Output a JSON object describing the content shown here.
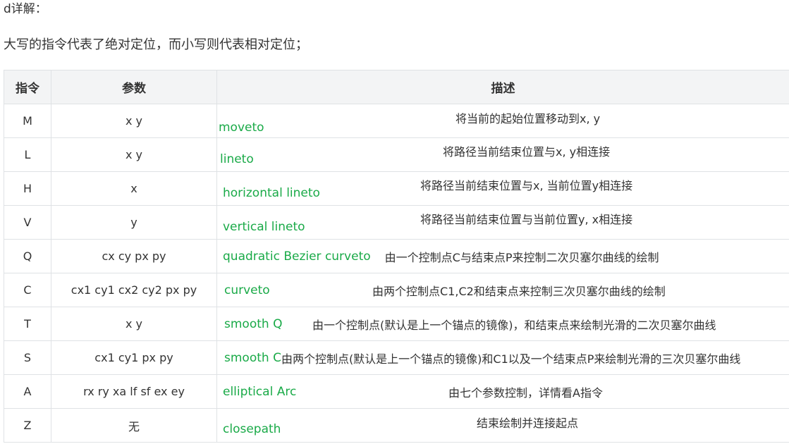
{
  "heading": "d详解：",
  "intro": "大写的指令代表了绝对定位，而小写则代表相对定位；",
  "table": {
    "headers": [
      "指令",
      "参数",
      "描述"
    ],
    "rows": [
      {
        "cmd": "M",
        "params": "x y",
        "name": "moveto",
        "desc": "将当前的起始位置移动到x, y"
      },
      {
        "cmd": "L",
        "params": "x y",
        "name": "lineto",
        "desc": "将路径当前结束位置与x, y相连接"
      },
      {
        "cmd": "H",
        "params": "x",
        "name": "horizontal lineto",
        "desc": "将路径当前结束位置与x, 当前位置y相连接"
      },
      {
        "cmd": "V",
        "params": "y",
        "name": "vertical lineto",
        "desc": "将路径当前结束位置与当前位置y, x相连接"
      },
      {
        "cmd": "Q",
        "params": "cx cy px py",
        "name": "quadratic Bezier curveto",
        "desc": "由一个控制点C与结束点P来控制二次贝塞尔曲线的绘制"
      },
      {
        "cmd": "C",
        "params": "cx1 cy1 cx2 cy2 px py",
        "name": "curveto",
        "desc": "由两个控制点C1,C2和结束点来控制三次贝塞尔曲线的绘制"
      },
      {
        "cmd": "T",
        "params": "x y",
        "name": "smooth Q",
        "desc": "由一个控制点(默认是上一个锚点的镜像)，和结束点来绘制光滑的二次贝塞尔曲线"
      },
      {
        "cmd": "S",
        "params": "cx1 cy1 px py",
        "name": "smooth C",
        "desc": "由两个控制点(默认是上一个锚点的镜像)和C1以及一个结束点P来绘制光滑的三次贝塞尔曲线"
      },
      {
        "cmd": "A",
        "params": "rx ry xa lf sf ex ey",
        "name": "elliptical Arc",
        "desc": "由七个参数控制，详情看A指令"
      },
      {
        "cmd": "Z",
        "params": "无",
        "name": "closepath",
        "desc": "结束绘制并连接起点"
      }
    ]
  }
}
